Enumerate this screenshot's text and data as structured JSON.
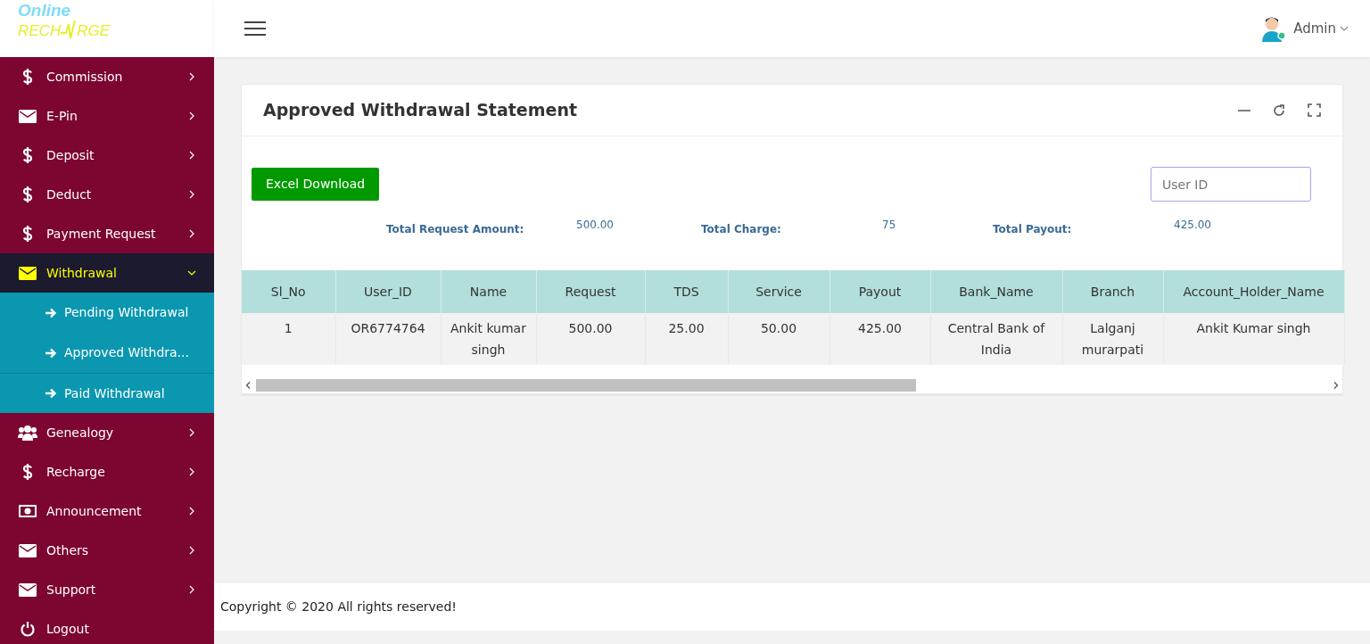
{
  "logo": {
    "line_1": "Online",
    "line_2_start": "RECH",
    "line_2_end": "RGE"
  },
  "header": {
    "user": "Admin"
  },
  "sidebar": {
    "items": [
      {
        "label": "Commission",
        "kind": "dollar",
        "expanded": false
      },
      {
        "label": "E-Pin",
        "kind": "mail",
        "expanded": false
      },
      {
        "label": "Deposit",
        "kind": "dollar",
        "expanded": false
      },
      {
        "label": "Deduct",
        "kind": "dollar",
        "expanded": false
      },
      {
        "label": "Payment Request",
        "kind": "dollar",
        "expanded": false
      },
      {
        "label": "Withdrawal",
        "kind": "mail",
        "expanded": true,
        "children": [
          {
            "label": "Pending Withdrawal"
          },
          {
            "label": "Approved Withdra..."
          },
          {
            "label": "Paid Withdrawal"
          }
        ]
      },
      {
        "label": "Genealogy",
        "kind": "users",
        "expanded": false
      },
      {
        "label": "Recharge",
        "kind": "dollar",
        "expanded": false
      },
      {
        "label": "Announcement",
        "kind": "money",
        "expanded": false
      },
      {
        "label": "Others",
        "kind": "mail",
        "expanded": false
      },
      {
        "label": "Support",
        "kind": "mail",
        "expanded": false
      },
      {
        "label": "Logout",
        "kind": "power"
      }
    ]
  },
  "panel": {
    "title": "Approved Withdrawal Statement",
    "download_button": "Excel Download",
    "search": {
      "placeholder": "User ID"
    },
    "totals": [
      {
        "label": "Total Request Amount:",
        "value": "500.00"
      },
      {
        "label": "Total Charge:",
        "value": "75"
      },
      {
        "label": "Total Payout:",
        "value": "425.00"
      }
    ],
    "table": {
      "columns": [
        "Sl_No",
        "User_ID",
        "Name",
        "Request",
        "TDS",
        "Service",
        "Payout",
        "Bank_Name",
        "Branch",
        "Account_Holder_Name"
      ],
      "rows": [
        [
          "1",
          "OR6774764",
          "Ankit kumar singh",
          "500.00",
          "25.00",
          "50.00",
          "425.00",
          "Central Bank of India",
          "Lalganj murarpati",
          "Ankit Kumar singh"
        ]
      ]
    }
  },
  "footer": {
    "text": "Copyright © 2020 All rights reserved!"
  }
}
